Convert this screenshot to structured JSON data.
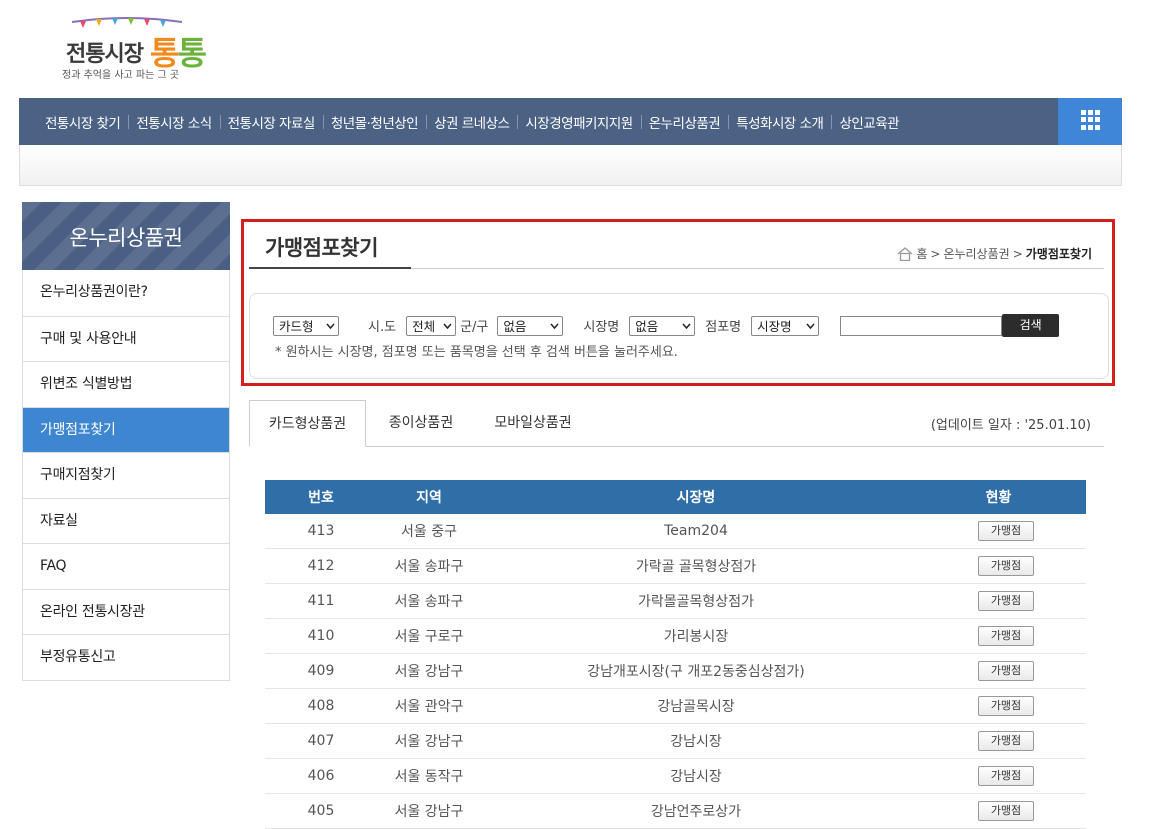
{
  "logo": {
    "brand": "전통시장",
    "accent1": "통",
    "accent2": "통",
    "slogan": "정과 추억을 사고 파는 그 곳"
  },
  "gnb": {
    "items": [
      "전통시장 찾기",
      "전통시장 소식",
      "전통시장 자료실",
      "청년몰·청년상인",
      "상권 르네상스",
      "시장경영패키지지원",
      "온누리상품권",
      "특성화시장 소개",
      "상인교육관"
    ],
    "menu_icon": "grid-icon"
  },
  "lnb": {
    "title": "온누리상품권",
    "items": [
      "온누리상품권이란?",
      "구매 및 사용안내",
      "위변조 식별방법",
      "가맹점포찾기",
      "구매지점찾기",
      "자료실",
      "FAQ",
      "온라인 전통시장관",
      "부정유통신고"
    ],
    "active_index": 3
  },
  "page": {
    "title": "가맹점포찾기",
    "breadcrumb": {
      "home": "홈",
      "parent": "온누리상품권",
      "current": "가맹점포찾기",
      "sep": ">"
    }
  },
  "search": {
    "type_select": "카드형",
    "sido_label": "시.도",
    "sido_select": "전체",
    "gungu_label": "군/구",
    "gungu_select": "없음",
    "market_label": "시장명",
    "market_select": "없음",
    "store_label": "점포명",
    "store_select": "시장명",
    "keyword_value": "",
    "button": "검색",
    "note": "* 원하시는 시장명, 점포명 또는 품목명을 선택 후 검색 버튼을 눌러주세요."
  },
  "tabs": {
    "items": [
      "카드형상품권",
      "종이상품권",
      "모바일상품권"
    ],
    "active_index": 0,
    "update_date": "(업데이트 일자 : '25.01.10)"
  },
  "table": {
    "headers": [
      "번호",
      "지역",
      "시장명",
      "현황"
    ],
    "rows": [
      {
        "no": "413",
        "region": "서울 중구",
        "market": "Team204",
        "status": "가맹점"
      },
      {
        "no": "412",
        "region": "서울 송파구",
        "market": "가락골 골목형상점가",
        "status": "가맹점"
      },
      {
        "no": "411",
        "region": "서울 송파구",
        "market": "가락몰골목형상점가",
        "status": "가맹점"
      },
      {
        "no": "410",
        "region": "서울 구로구",
        "market": "가리봉시장",
        "status": "가맹점"
      },
      {
        "no": "409",
        "region": "서울 강남구",
        "market": "강남개포시장(구 개포2동중심상점가)",
        "status": "가맹점"
      },
      {
        "no": "408",
        "region": "서울 관악구",
        "market": "강남골목시장",
        "status": "가맹점"
      },
      {
        "no": "407",
        "region": "서울 강남구",
        "market": "강남시장",
        "status": "가맹점"
      },
      {
        "no": "406",
        "region": "서울 동작구",
        "market": "강남시장",
        "status": "가맹점"
      },
      {
        "no": "405",
        "region": "서울 강남구",
        "market": "강남언주로상가",
        "status": "가맹점"
      }
    ]
  },
  "colors": {
    "gnb": "#4b6285",
    "accent_blue": "#3f86d1",
    "table_header": "#2f6ea6",
    "highlight": "#d41f1f"
  }
}
